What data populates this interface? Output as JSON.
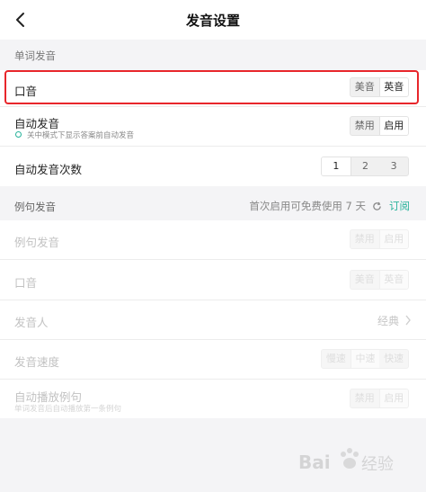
{
  "header": {
    "title": "发音设置"
  },
  "word_section": {
    "title": "单词发音"
  },
  "accent": {
    "label": "口音",
    "options": [
      "美音",
      "英音"
    ],
    "selected": "英音"
  },
  "auto_play": {
    "label": "自动发音",
    "hint": "关中模式下显示答案前自动发音",
    "options": [
      "禁用",
      "启用"
    ],
    "selected": "启用"
  },
  "auto_count": {
    "label": "自动发音次数",
    "options": [
      "1",
      "2",
      "3"
    ],
    "selected": "1"
  },
  "sentence_section": {
    "title": "例句发音",
    "promo": "首次启用可免费使用 7 天",
    "subscribe": "订阅"
  },
  "sentence_voice": {
    "label": "例句发音",
    "options": [
      "禁用",
      "启用"
    ]
  },
  "sentence_accent": {
    "label": "口音",
    "options": [
      "美音",
      "英音"
    ]
  },
  "speaker": {
    "label": "发音人",
    "value": "经典"
  },
  "speed": {
    "label": "发音速度",
    "options": [
      "慢速",
      "中速",
      "快速"
    ]
  },
  "auto_sentence": {
    "label": "自动播放例句",
    "hint": "单词发音后自动播放第一条例句",
    "options": [
      "禁用",
      "启用"
    ]
  },
  "watermark": {
    "text": "Bai 经验"
  },
  "colors": {
    "accent": "#27b29a",
    "highlight": "#e8262b"
  }
}
